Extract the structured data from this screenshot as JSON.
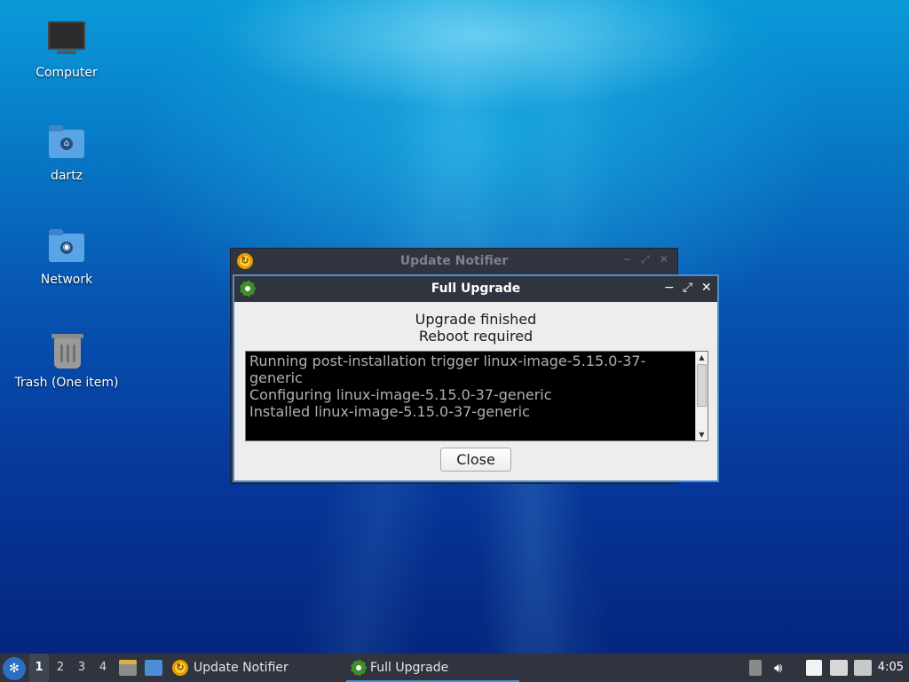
{
  "desktop": {
    "icons": [
      {
        "label": "Computer"
      },
      {
        "label": "dartz"
      },
      {
        "label": "Network"
      },
      {
        "label": "Trash (One item)"
      }
    ]
  },
  "back_window": {
    "title": "Update Notifier",
    "controls": [
      "−",
      "⤢",
      "✕"
    ]
  },
  "front_window": {
    "title": "Full Upgrade",
    "controls": [
      "−",
      "⤢",
      "✕"
    ],
    "status_line1": "Upgrade finished",
    "status_line2": "Reboot required",
    "log_lines": [
      "Running post-installation trigger linux-image-5.15.0-37-",
      "generic",
      "Configuring linux-image-5.15.0-37-generic",
      "Installed linux-image-5.15.0-37-generic"
    ],
    "close_label": "Close"
  },
  "taskbar": {
    "workspaces": [
      "1",
      "2",
      "3",
      "4"
    ],
    "active_workspace": "1",
    "tasks": [
      {
        "label": "Update Notifier",
        "icon": "update-notifier-icon"
      },
      {
        "label": "Full Upgrade",
        "icon": "gear-icon"
      }
    ],
    "clock": "4:05",
    "accent": "#4a8ed6"
  }
}
